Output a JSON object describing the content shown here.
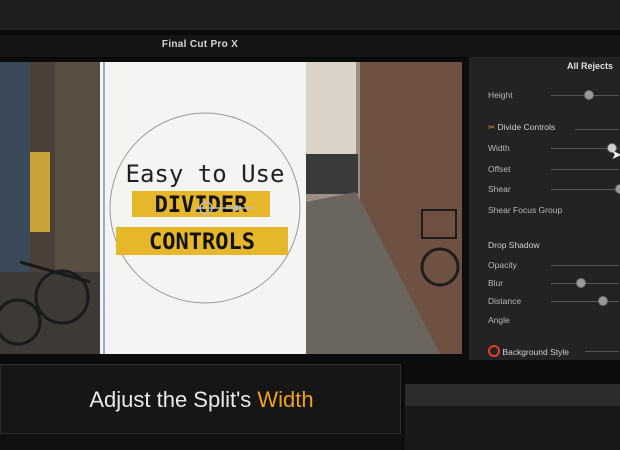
{
  "app": {
    "title": "Final Cut Pro X"
  },
  "inspector": {
    "tab_label": "All Rejects",
    "rows": {
      "height": "Height",
      "divide_controls": "Divide Controls",
      "width": "Width",
      "offset": "Offset",
      "shear": "Shear",
      "shear_focus_group": "Shear Focus Group",
      "drop_shadow": "Drop Shadow",
      "opacity": "Opacity",
      "blur": "Blur",
      "distance": "Distance",
      "angle": "Angle",
      "background_style": "Background Style"
    }
  },
  "overlay": {
    "line1": "Easy to Use",
    "line2": "DIVIDER",
    "line3": "CONTROLS"
  },
  "caption": {
    "prefix": "Adjust the Split's ",
    "highlight": "Width"
  },
  "colors": {
    "accent_orange": "#f0a02a",
    "label_yellow": "#e6b72a"
  }
}
